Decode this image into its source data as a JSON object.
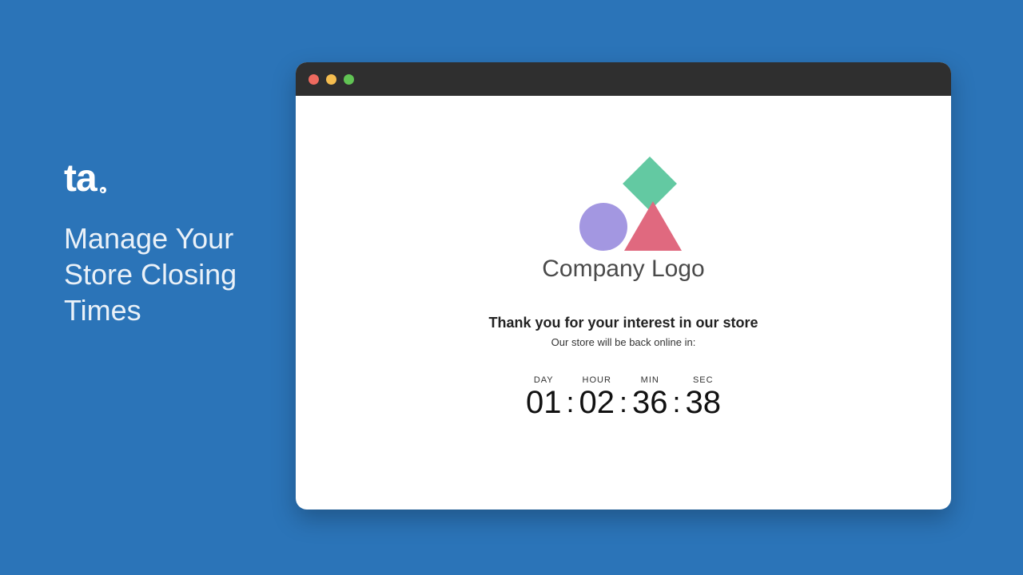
{
  "brand": {
    "mark": "ta"
  },
  "tagline": "Manage Your Store Closing Times",
  "window": {
    "logo_text": "Company Logo",
    "headline": "Thank you for your interest in our store",
    "subline": "Our store will be back online in:",
    "countdown": {
      "labels": {
        "day": "DAY",
        "hour": "HOUR",
        "min": "MIN",
        "sec": "SEC"
      },
      "values": {
        "day": "01",
        "hour": "02",
        "min": "36",
        "sec": "38"
      },
      "separator": ":"
    }
  },
  "colors": {
    "page_bg": "#2b74b8",
    "titlebar": "#2f2f2f",
    "dot_red": "#ee6a5f",
    "dot_yellow": "#f5bd4f",
    "dot_green": "#61c454",
    "logo_circle": "#a397e1",
    "logo_triangle": "#e0697f",
    "logo_diamond": "#63c9a2"
  }
}
